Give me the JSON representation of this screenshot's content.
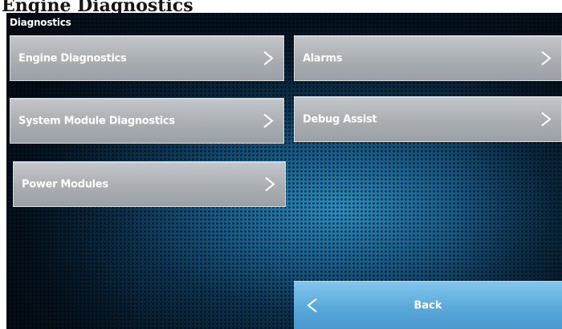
{
  "caption": "Engine Diagnostics",
  "screen": {
    "title": "Diagnostics"
  },
  "menu": [
    {
      "label": "Engine Diagnostics",
      "icon": "chevron-right-icon"
    },
    {
      "label": "Alarms",
      "icon": "chevron-right-icon"
    },
    {
      "label": "System Module Diagnostics",
      "icon": "chevron-right-icon"
    },
    {
      "label": "Debug Assist",
      "icon": "chevron-right-icon"
    },
    {
      "label": "Power Modules",
      "icon": "chevron-right-icon"
    }
  ],
  "back": {
    "label": "Back",
    "icon": "chevron-left-icon"
  },
  "colors": {
    "button_gray": "#a9aeb3",
    "back_blue": "#5aa9dc",
    "background_blue": "#17608f"
  }
}
